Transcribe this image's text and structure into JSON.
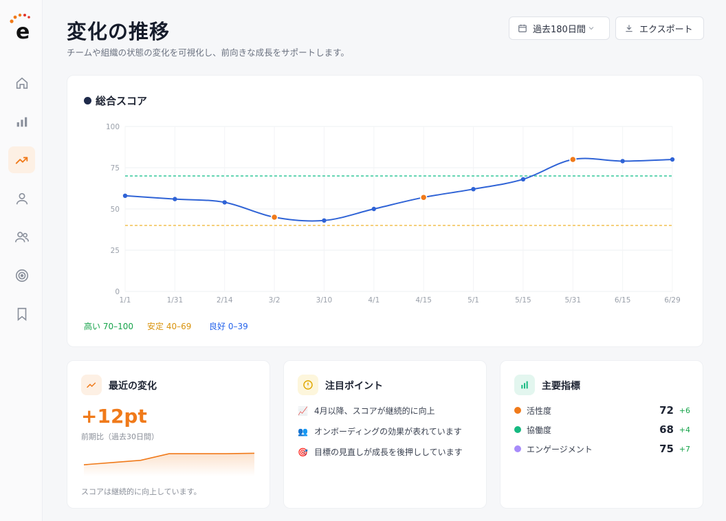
{
  "header": {
    "title": "変化の推移",
    "subtitle": "チームや組織の状態の変化を可視化し、前向きな成長をサポートします。",
    "period_label": "過去180日間",
    "export_label": "エクスポート"
  },
  "sidebar": {
    "items": [
      {
        "name": "home-icon",
        "active": false
      },
      {
        "name": "bar-chart-icon",
        "active": false
      },
      {
        "name": "trend-icon",
        "active": true
      },
      {
        "name": "user-icon",
        "active": false
      },
      {
        "name": "users-icon",
        "active": false
      },
      {
        "name": "target-icon",
        "active": false
      },
      {
        "name": "bookmark-icon",
        "active": false
      }
    ]
  },
  "chart_card": {
    "title": "総合スコア",
    "legend": [
      {
        "label": "高い 70–100",
        "color": "#16a34a"
      },
      {
        "label": "安定 40–69",
        "color": "#d9930d"
      },
      {
        "label": "良好 0–39",
        "color": "#2563eb"
      }
    ]
  },
  "chart_data": {
    "type": "line",
    "title": "総合スコア",
    "x": [
      "1/1",
      "1/31",
      "2/14",
      "3/2",
      "3/10",
      "4/1",
      "4/15",
      "5/1",
      "5/15",
      "5/31",
      "6/15",
      "6/29"
    ],
    "series": [
      {
        "values": [
          58,
          56,
          54,
          45,
          43,
          50,
          57,
          62,
          68,
          80,
          79,
          80
        ],
        "color": "#2f63d6"
      }
    ],
    "highlight_indices": [
      3,
      6,
      9
    ],
    "highlight_color": "#f07a1a",
    "yticks": [
      0,
      25,
      50,
      75,
      100
    ],
    "ylim": [
      0,
      100
    ],
    "reference_lines": [
      {
        "value": 70,
        "color": "#34c79a"
      },
      {
        "value": 40,
        "color": "#f2c14e"
      }
    ],
    "grid": true
  },
  "recent_change": {
    "title": "最近の変化",
    "value": "+12pt",
    "compare": "前期比（過去30日間）",
    "caption": "スコアは継続的に向上しています。",
    "spark_values": [
      62,
      63,
      64,
      67,
      67,
      67,
      67.2
    ]
  },
  "attention": {
    "title": "注目ポイント",
    "items": [
      {
        "icon": "📈",
        "text": "4月以降、スコアが継続的に向上"
      },
      {
        "icon": "👥",
        "text": "オンボーディングの効果が表れています"
      },
      {
        "icon": "🎯",
        "text": "目標の見直しが成長を後押ししています"
      }
    ]
  },
  "metrics": {
    "title": "主要指標",
    "items": [
      {
        "label": "活性度",
        "value": "72",
        "delta": "+6",
        "color": "#f07a1a"
      },
      {
        "label": "協働度",
        "value": "68",
        "delta": "+4",
        "color": "#16b981"
      },
      {
        "label": "エンゲージメント",
        "value": "75",
        "delta": "+7",
        "color": "#a78bfa"
      }
    ]
  }
}
